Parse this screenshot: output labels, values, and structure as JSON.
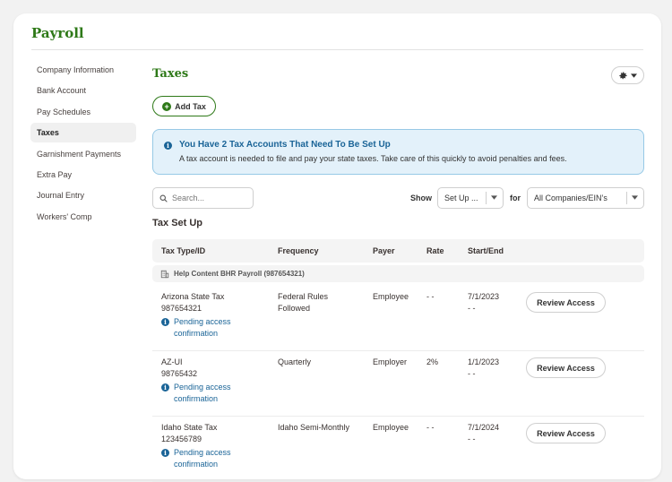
{
  "app": {
    "title": "Payroll"
  },
  "sidebar": {
    "items": [
      {
        "label": "Company Information",
        "active": false
      },
      {
        "label": "Bank Account",
        "active": false
      },
      {
        "label": "Pay Schedules",
        "active": false
      },
      {
        "label": "Taxes",
        "active": true
      },
      {
        "label": "Garnishment Payments",
        "active": false
      },
      {
        "label": "Extra Pay",
        "active": false
      },
      {
        "label": "Journal Entry",
        "active": false
      },
      {
        "label": "Workers' Comp",
        "active": false
      }
    ]
  },
  "page": {
    "title": "Taxes",
    "add_button": "Add Tax"
  },
  "alert": {
    "title": "You Have 2 Tax Accounts That Need To Be Set Up",
    "body": "A tax account is needed to file and pay your state taxes. Take care of this quickly to avoid penalties and fees."
  },
  "filters": {
    "search_placeholder": "Search...",
    "show_label": "Show",
    "show_value": "Set Up ...",
    "for_label": "for",
    "for_value": "All Companies/EIN’s"
  },
  "section": {
    "title": "Tax Set Up"
  },
  "table": {
    "headers": [
      "Tax Type/ID",
      "Frequency",
      "Payer",
      "Rate",
      "Start/End"
    ],
    "group_label": "Help Content BHR Payroll (987654321)",
    "rows": [
      {
        "tax_type": "Arizona State Tax",
        "tax_id": "987654321",
        "frequency": "Federal Rules Followed",
        "payer": "Employee",
        "rate": "- -",
        "start": "7/1/2023",
        "end": "- -",
        "status": "Pending access confirmation",
        "action": "Review Access"
      },
      {
        "tax_type": "AZ-UI",
        "tax_id": "98765432",
        "frequency": "Quarterly",
        "payer": "Employer",
        "rate": "2%",
        "start": "1/1/2023",
        "end": "- -",
        "status": "Pending access confirmation",
        "action": "Review Access"
      },
      {
        "tax_type": "Idaho State Tax",
        "tax_id": "123456789",
        "frequency": "Idaho Semi-Monthly",
        "payer": "Employee",
        "rate": "- -",
        "start": "7/1/2024",
        "end": "- -",
        "status": "Pending access confirmation",
        "action": "Review Access"
      }
    ]
  },
  "colors": {
    "brand_green": "#2e7918",
    "info_blue": "#1a6497",
    "alert_bg": "#e3f1fa"
  }
}
